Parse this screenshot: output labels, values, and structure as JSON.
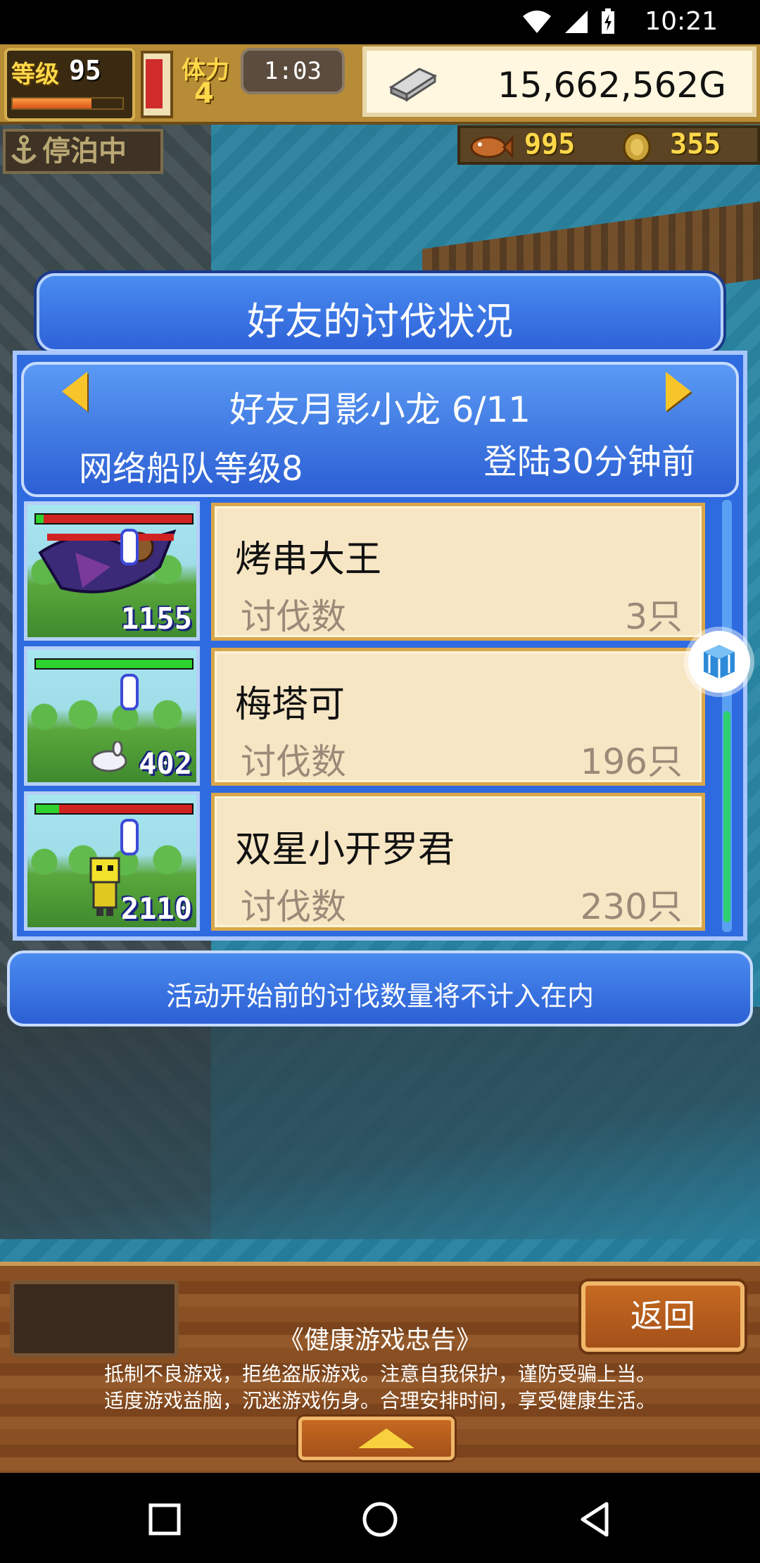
{
  "status_bar": {
    "time": "10:21"
  },
  "hud": {
    "level_label": "等级",
    "level_value": "95",
    "exp_progress": 0.72,
    "stamina_label": "体力",
    "stamina_value": "4",
    "stamina_gauge": 0.95,
    "timer": "1:03",
    "money": "15,662,562G",
    "docked_status": "停泊中",
    "resource_fish": "995",
    "resource_coin": "355"
  },
  "dialog": {
    "title": "好友的讨伐状况",
    "friend_name": "好友月影小龙 6/11",
    "fleet_level": "网络船队等级8",
    "login_time": "登陆30分钟前",
    "rows": [
      {
        "name": "烤串大王",
        "kill_label": "讨伐数",
        "kill_value": "3只",
        "thumb_count": "1155",
        "hp": 0.05
      },
      {
        "name": "梅塔可",
        "kill_label": "讨伐数",
        "kill_value": "196只",
        "thumb_count": "402",
        "hp": 1.0
      },
      {
        "name": "双星小开罗君",
        "kill_label": "讨伐数",
        "kill_value": "230只",
        "thumb_count": "2110",
        "hp": 0.15
      }
    ],
    "footnote": "活动开始前的讨伐数量将不计入在内"
  },
  "bottom": {
    "back_label": "返回",
    "notice_title": "《健康游戏忠告》",
    "notice_line1": "抵制不良游戏，拒绝盗版游戏。注意自我保护，谨防受骗上当。",
    "notice_line2": "适度游戏益脑，沉迷游戏伤身。合理安排时间，享受健康生活。"
  },
  "icons": [
    "wifi-icon",
    "signal-icon",
    "battery-icon",
    "silver-bar-icon",
    "anchor-icon",
    "fish-icon",
    "coin-icon",
    "arrow-left-icon",
    "arrow-right-icon",
    "cube-icon",
    "triangle-up-icon",
    "nav-recents-icon",
    "nav-home-icon",
    "nav-back-icon"
  ]
}
